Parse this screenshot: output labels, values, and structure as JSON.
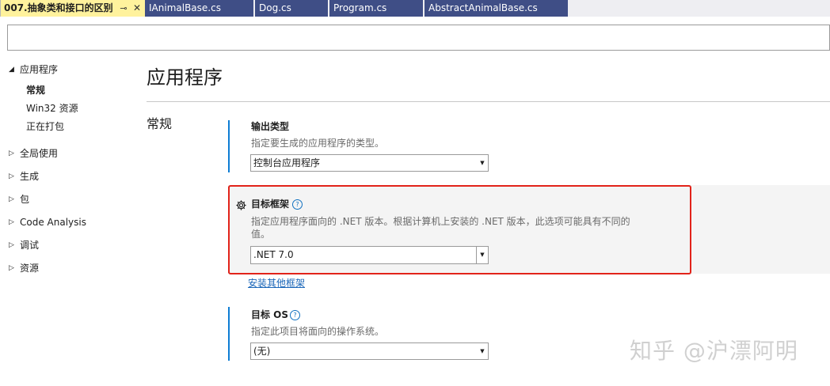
{
  "tabs": [
    {
      "label": "007.抽象类和接口的区别",
      "active": true
    },
    {
      "label": "IAnimalBase.cs"
    },
    {
      "label": "Dog.cs"
    },
    {
      "label": "Program.cs"
    },
    {
      "label": "AbstractAnimalBase.cs"
    }
  ],
  "tab_icons": {
    "pin": "⊸",
    "close": "✕"
  },
  "search": {
    "value": "",
    "placeholder": ""
  },
  "nav": {
    "app": {
      "label": "应用程序",
      "arrow": "◢"
    },
    "sub": [
      "常规",
      "Win32 资源",
      "正在打包"
    ],
    "groups": [
      "全局使用",
      "生成",
      "包",
      "Code Analysis",
      "调试",
      "资源"
    ],
    "collapsed_arrow": "▷"
  },
  "page": {
    "title": "应用程序",
    "section": "常规"
  },
  "output_type": {
    "label": "输出类型",
    "desc": "指定要生成的应用程序的类型。",
    "value": "控制台应用程序"
  },
  "target_framework": {
    "label": "目标框架",
    "desc_line1": "指定应用程序面向的 .NET 版本。根据计算机上安装的 .NET 版本，此选项可能具有不同的",
    "desc_line2": "值。",
    "value": ".NET 7.0",
    "help": "?"
  },
  "install_link": "安装其他框架",
  "target_os": {
    "label": "目标 OS",
    "desc": "指定此项目将面向的操作系统。",
    "value": "(无)",
    "help": "?"
  },
  "combo_arrow": "▼",
  "watermark": "知乎 @沪漂阿明",
  "colors": {
    "accent": "#0e7dd4",
    "highlight_border": "#e2231a",
    "tab_active": "#fff29d",
    "tab_inactive": "#3f4e86"
  }
}
